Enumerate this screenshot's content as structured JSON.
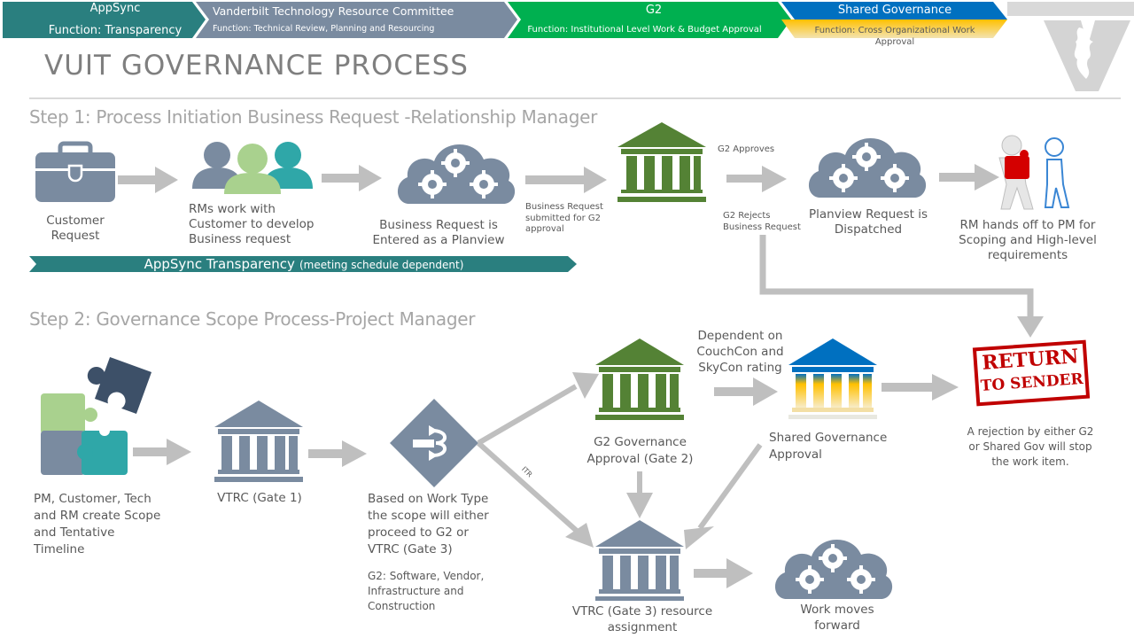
{
  "banner": {
    "segments": [
      {
        "title": "AppSync",
        "function": "Function: Transparency",
        "color": "#2a7f7f"
      },
      {
        "title": "Vanderbilt Technology Resource Committee",
        "function": "Function: Technical Review, Planning and Resourcing",
        "color": "#7a8ba0"
      },
      {
        "title": "G2",
        "function": "Function: Institutional Level Work  & Budget Approval",
        "color": "#00b050"
      },
      {
        "title": "Shared Governance",
        "function": "Function: Cross Organizational Work Approval",
        "color": "#0070c0",
        "accent": "#ffc000"
      }
    ]
  },
  "page_title": "VUIT GOVERNANCE  PROCESS",
  "step1": {
    "title": "Step 1: Process Initiation  Business Request -Relationship Manager",
    "nodes": {
      "customer_request": "Customer Request",
      "rms_work": "RMs work with Customer to develop Business request",
      "business_request_entered": "Business Request is Entered as a  Planview",
      "submitted_for_g2": "Business Request submitted for G2 approval",
      "g2_approves": "G2 Approves",
      "g2_rejects": "G2 Rejects Business Request",
      "planview_dispatched": "Planview Request is Dispatched",
      "rm_handoff": "RM hands off to PM for Scoping and High-level requirements"
    },
    "appsync_bar": {
      "main": "AppSync Transparency",
      "note": "(meeting schedule dependent)"
    }
  },
  "step2": {
    "title": "Step 2: Governance Scope Process-Project Manager",
    "nodes": {
      "pm_create": "PM, Customer, Tech and RM create Scope and Tentative Timeline",
      "vtrc_gate1": "VTRC (Gate 1)",
      "work_type": "Based on Work Type the scope will either proceed to G2 or VTRC (Gate 3)",
      "work_type_note": "G2: Software, Vendor, Infrastructure and Construction",
      "itr_label": "ITR",
      "g2_gate2": "G2 Governance Approval (Gate 2)",
      "dependent_on": "Dependent on CouchCon and SkyCon rating",
      "shared_gov_approval": "Shared Governance Approval",
      "return_stamp_line1": "RETURN",
      "return_stamp_line2": "TO SENDER",
      "rejection_note": "A rejection by either G2 or Shared Gov will stop the work item.",
      "vtrc_gate3": "VTRC (Gate 3) resource assignment",
      "work_moves": "Work moves forward"
    }
  },
  "colors": {
    "icon_slate": "#7a8ba0",
    "arrow_gray": "#bfbfbf",
    "g2_green": "#548235",
    "shared_blue": "#0070c0",
    "shared_gold": "#ffc000",
    "teal": "#2a7f7f",
    "stamp_red": "#c00000"
  }
}
